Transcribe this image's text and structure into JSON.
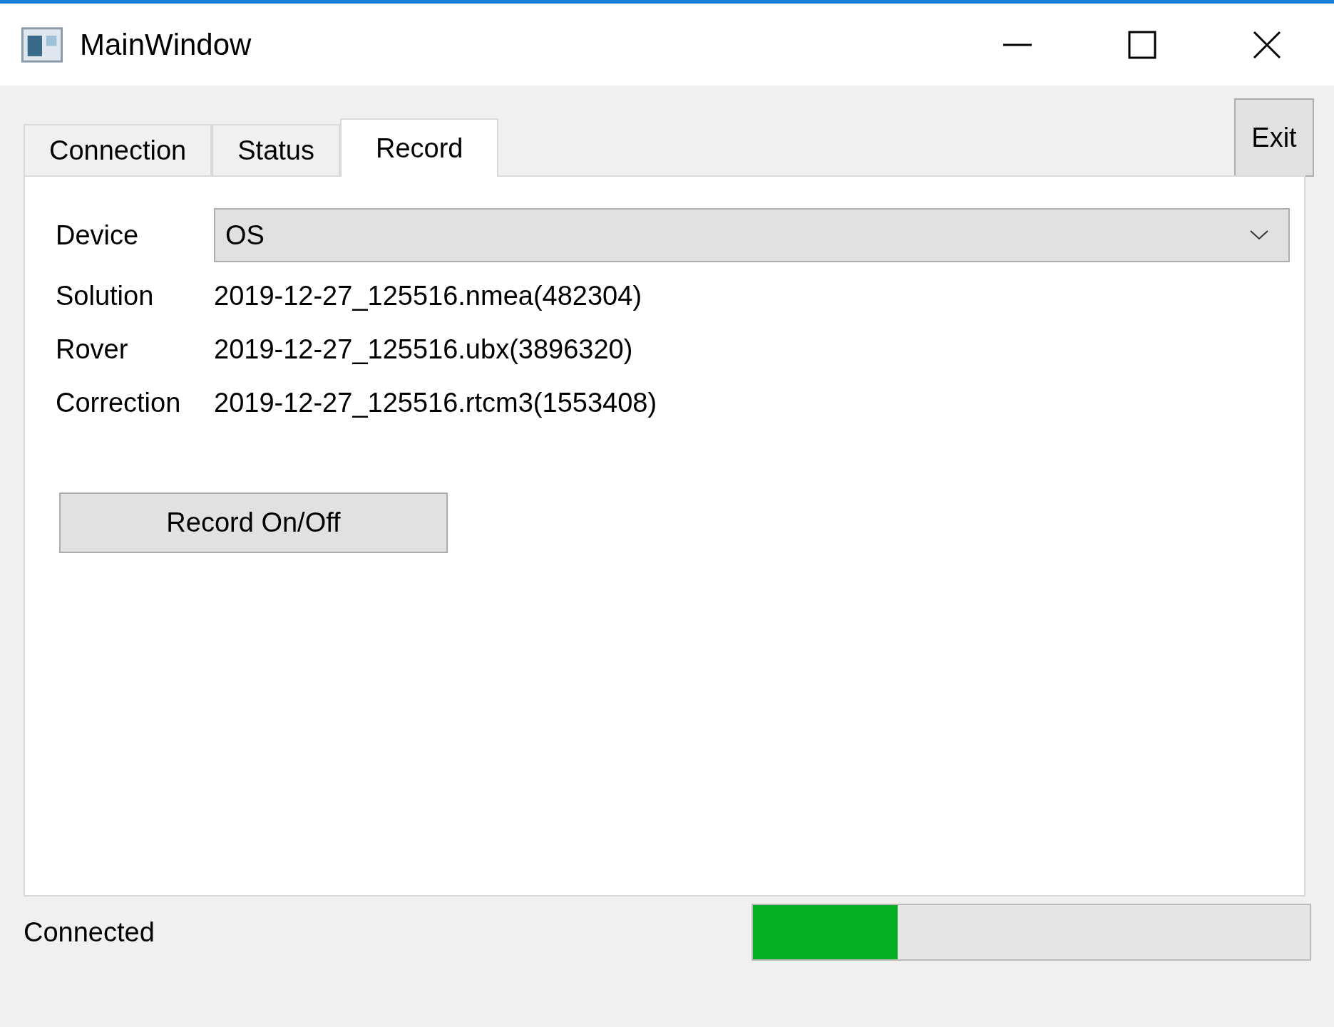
{
  "window": {
    "title": "MainWindow"
  },
  "tabs": [
    {
      "label": "Connection",
      "selected": false
    },
    {
      "label": "Status",
      "selected": false
    },
    {
      "label": "Record",
      "selected": true
    }
  ],
  "exit_button": "Exit",
  "device": {
    "label": "Device",
    "value": "OS"
  },
  "fields": [
    {
      "label": "Solution",
      "value": "2019-12-27_125516.nmea(482304)"
    },
    {
      "label": "Rover",
      "value": "2019-12-27_125516.ubx(3896320)"
    },
    {
      "label": "Correction",
      "value": "2019-12-27_125516.rtcm3(1553408)"
    }
  ],
  "record_button": "Record On/Off",
  "status_bar": {
    "text": "Connected",
    "progress": {
      "level": 0.26
    }
  }
}
